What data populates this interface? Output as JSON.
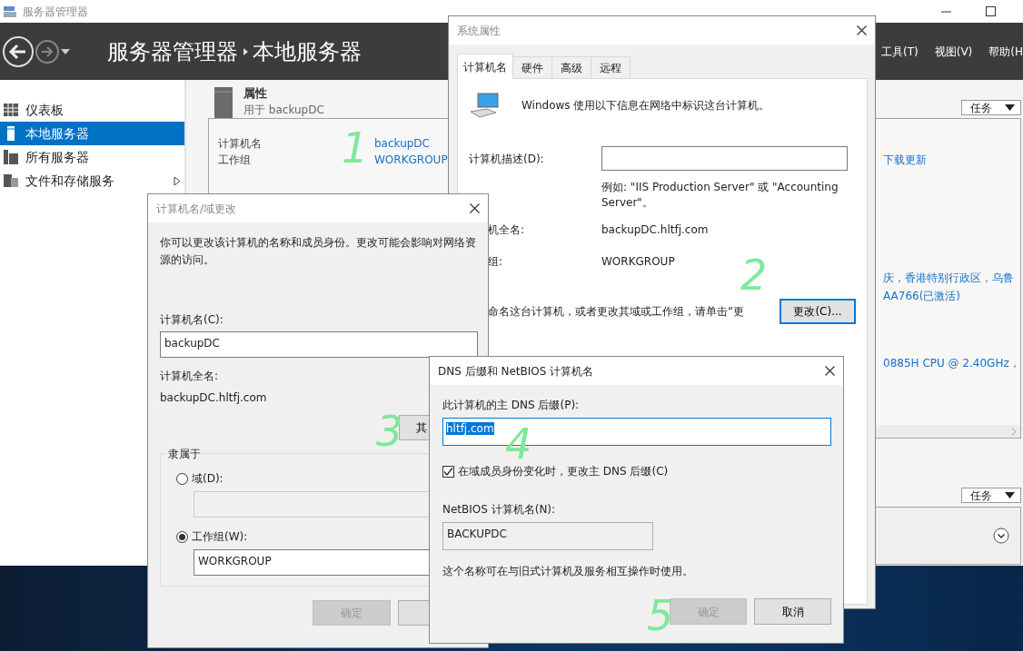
{
  "window": {
    "title": "服务器管理器"
  },
  "header": {
    "breadcrumb": [
      "服务器管理器",
      "本地服务器"
    ],
    "menu": [
      "工具(T)",
      "视图(V)",
      "帮助(H"
    ]
  },
  "sidebar": {
    "items": [
      {
        "label": "仪表板",
        "selected": false,
        "kind": "dashboard",
        "expandable": false
      },
      {
        "label": "本地服务器",
        "selected": true,
        "kind": "server",
        "expandable": false
      },
      {
        "label": "所有服务器",
        "selected": false,
        "kind": "servers",
        "expandable": false
      },
      {
        "label": "文件和存储服务",
        "selected": false,
        "kind": "storage",
        "expandable": true
      }
    ]
  },
  "properties": {
    "title": "属性",
    "subtitle": "用于 backupDC",
    "tasks": "任务",
    "rows": [
      {
        "label": "计算机名",
        "value": "backupDC"
      },
      {
        "label": "工作组",
        "value": "WORKGROUP"
      }
    ],
    "right_texts": [
      "下载更新",
      "庆，香港特别行政区，乌鲁",
      "AA766(已激活)",
      "0885H CPU @ 2.40GHz，"
    ]
  },
  "events": {
    "tasks": "任务"
  },
  "system_properties": {
    "title": "系统属性",
    "tabs": [
      {
        "label": "计算机名",
        "selected": true
      },
      {
        "label": "硬件",
        "selected": false
      },
      {
        "label": "高级",
        "selected": false
      },
      {
        "label": "远程",
        "selected": false
      }
    ],
    "intro": "Windows 使用以下信息在网络中标识这台计算机。",
    "description_label": "计算机描述(D):",
    "example": "例如: \"IIS Production Server\" 或 \"Accounting Server\"。",
    "full_name_label": "机全名:",
    "full_name": "backupDC.hltfj.com",
    "workgroup_label": "组:",
    "workgroup": "WORKGROUP",
    "rename_text": "命名这台计算机，或者更改其域或工作组，请单击“更",
    "change_button": "更改(C)..."
  },
  "name_change_dialog": {
    "title": "计算机名/域更改",
    "intro": "你可以更改该计算机的名称和成员身份。更改可能会影响对网络资源的访问。",
    "computer_name_label": "计算机名(C):",
    "computer_name": "backupDC",
    "full_name_label": "计算机全名:",
    "full_name": "backupDC.hltfj.com",
    "more_button": "其",
    "member_of": "隶属于",
    "options": [
      {
        "label": "域(D):",
        "selected": false
      },
      {
        "label": "工作组(W):",
        "selected": true,
        "value": "WORKGROUP"
      }
    ],
    "ok_button": {
      "label": "确定",
      "disabled": true
    }
  },
  "dns_dialog": {
    "title": "DNS 后缀和 NetBIOS 计算机名",
    "suffix_label": "此计算机的主 DNS 后缀(P):",
    "suffix": "hltfj.com",
    "suffix_selected": true,
    "checkbox": {
      "label": "在域成员身份变化时，更改主 DNS 后缀(C)",
      "checked": true
    },
    "netbios_label": "NetBIOS 计算机名(N):",
    "netbios": "BACKUPDC",
    "note": "这个名称可在与旧式计算机及服务相互操作时使用。",
    "buttons": [
      {
        "label": "确定",
        "disabled": true
      },
      {
        "label": "取消",
        "disabled": false
      }
    ]
  },
  "annotations": [
    "1",
    "2",
    "3",
    "4",
    "5"
  ]
}
